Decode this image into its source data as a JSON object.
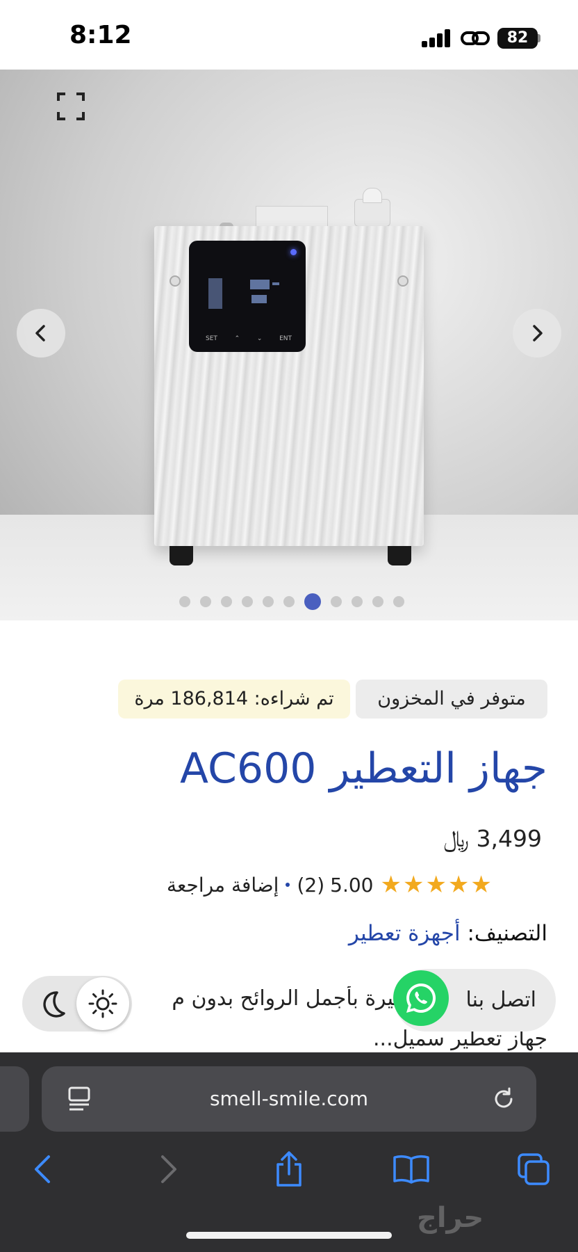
{
  "status_bar": {
    "time": "8:12",
    "battery": "82"
  },
  "gallery": {
    "total_images": 11,
    "active_index": 6
  },
  "product": {
    "stock_label": "متوفر في المخزون",
    "bought_label": "تم شراءه: 186,814 مرة",
    "title": "جهاز التعطير AC600",
    "price": "3,499 ﷼",
    "rating": "5.00",
    "reviews_count": "(2)",
    "add_review_label": "إضافة مراجعة",
    "category_label": "التصنيف:",
    "category_value": "أجهزة تعطير",
    "description_line1": "كبيرة بأجمل الروائح بدون م",
    "description_line2": "جهاز تعطير سميل..."
  },
  "contact": {
    "label": "اتصل بنا"
  },
  "browser": {
    "url": "smell-smile.com"
  },
  "watermark": "حراج",
  "colors": {
    "accent": "#2446a8",
    "star": "#f2a91e",
    "whatsapp": "#25d366",
    "toolbar_icon": "#3d8bff"
  }
}
